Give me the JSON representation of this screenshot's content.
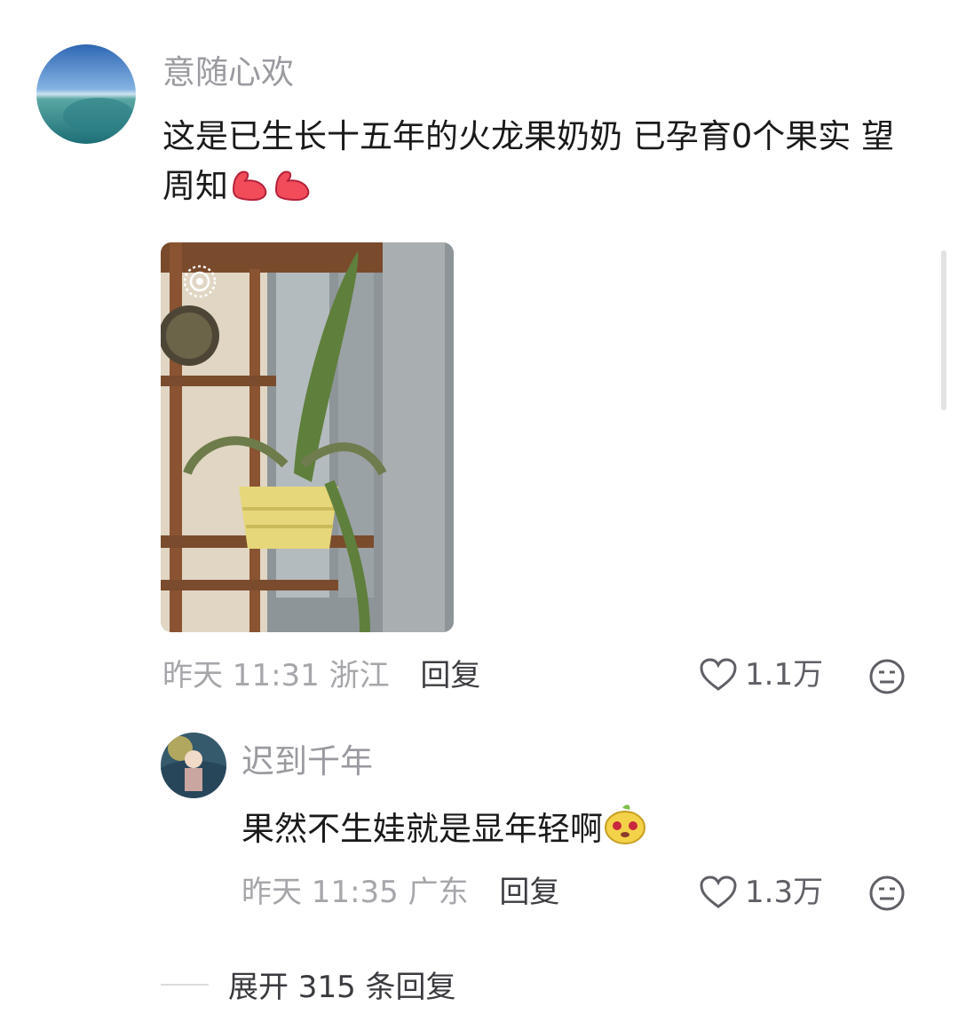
{
  "comments": [
    {
      "username": "意随心欢",
      "text": "这是已生长十五年的火龙果奶奶 已孕育0个果实 望周知",
      "time": "昨天 11:31",
      "location": "浙江",
      "reply_label": "回复",
      "likes": "1.1万"
    }
  ],
  "replies": [
    {
      "username": "迟到千年",
      "text": "果然不生娃就是显年轻啊",
      "time": "昨天 11:35",
      "location": "广东",
      "reply_label": "回复",
      "likes": "1.3万"
    }
  ],
  "expand_label": "展开 315 条回复",
  "icons": {
    "like": "heart-outline-icon",
    "dislike": "neutral-face-icon",
    "live_photo": "live-photo-icon",
    "emoji_1": "flexed-biceps-emoji",
    "emoji_2": "cute-face-emoji"
  },
  "colors": {
    "username": "#9a9aa0",
    "text": "#1a1a1a",
    "meta": "#a6a6ab"
  }
}
